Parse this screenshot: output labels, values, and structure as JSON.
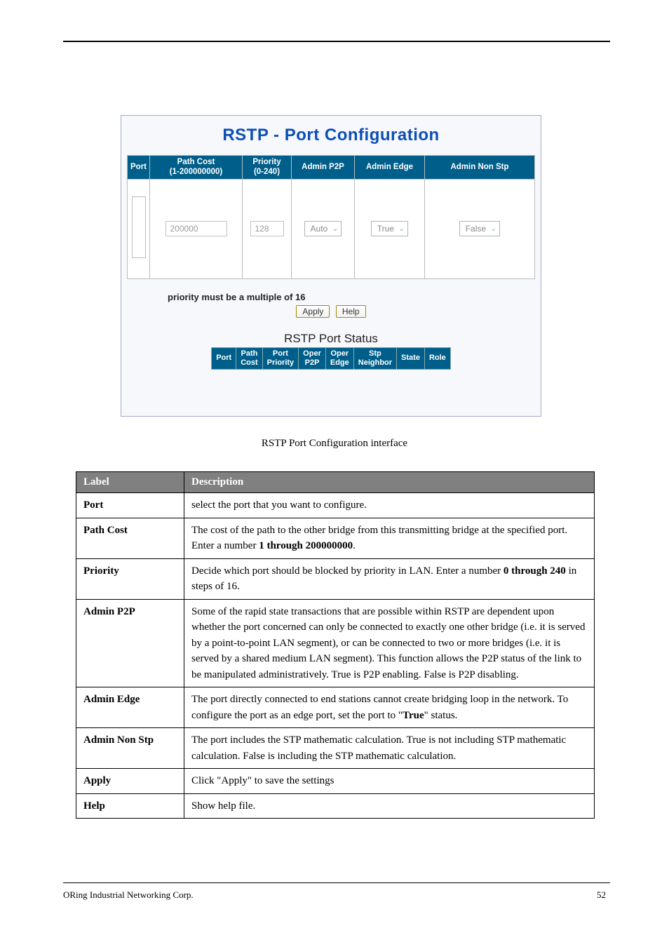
{
  "figure": {
    "title": "RSTP - Port Configuration",
    "cfg_headers": {
      "port": "Port",
      "path_cost_line1": "Path Cost",
      "path_cost_line2": "(1-200000000)",
      "priority_line1": "Priority",
      "priority_line2": "(0-240)",
      "admin_p2p": "Admin P2P",
      "admin_edge": "Admin Edge",
      "admin_nonstp": "Admin Non Stp"
    },
    "row": {
      "path_cost": "200000",
      "priority": "128",
      "admin_p2p": "Auto",
      "admin_edge": "True",
      "admin_nonstp": "False"
    },
    "note": "priority must be a multiple of 16",
    "buttons": {
      "apply": "Apply",
      "help": "Help"
    },
    "status_title": "RSTP Port Status",
    "status_headers": {
      "port": "Port",
      "path_cost_l1": "Path",
      "path_cost_l2": "Cost",
      "port_priority_l1": "Port",
      "port_priority_l2": "Priority",
      "oper_p2p_l1": "Oper",
      "oper_p2p_l2": "P2P",
      "oper_edge_l1": "Oper",
      "oper_edge_l2": "Edge",
      "stp_neighbor_l1": "Stp",
      "stp_neighbor_l2": "Neighbor",
      "state": "State",
      "role": "Role"
    }
  },
  "caption": "RSTP Port Configuration interface",
  "desc": {
    "header_label": "Label",
    "header_desc": "Description",
    "rows": [
      {
        "label": "Port",
        "desc": "select the port that you want to configure."
      },
      {
        "label": "Path Cost",
        "desc_parts": [
          "The cost of the path to the other bridge from this transmitting bridge at the specified port. Enter a number ",
          "1 through 200000000",
          "."
        ]
      },
      {
        "label": "Priority",
        "desc_parts": [
          "Decide which port should be blocked by priority in LAN. Enter a number ",
          "0 through 240",
          " in steps of 16."
        ]
      },
      {
        "label": "Admin P2P",
        "desc": "Some of the rapid state transactions that are possible within RSTP are dependent upon whether the port concerned can only be connected to exactly one other bridge (i.e. it is served by a point-to-point LAN segment), or can be connected to two or more bridges (i.e. it is served by a shared medium LAN segment). This function allows the P2P status of the link to be manipulated administratively. True is P2P enabling. False is P2P disabling."
      },
      {
        "label": "Admin Edge",
        "desc_parts": [
          "The port directly connected to end stations cannot create bridging loop in the network. To configure the port as an edge port, set the port to \"",
          "True",
          "\" status."
        ]
      },
      {
        "label": "Admin Non Stp",
        "desc": "The port includes the STP mathematic calculation. True is not including STP mathematic calculation. False is including the STP mathematic calculation."
      },
      {
        "label": "Apply",
        "desc": "Click \"Apply\" to save the settings"
      },
      {
        "label": "Help",
        "desc": "Show help file."
      }
    ]
  },
  "footer": {
    "left": "ORing Industrial Networking Corp.",
    "right": "52"
  }
}
